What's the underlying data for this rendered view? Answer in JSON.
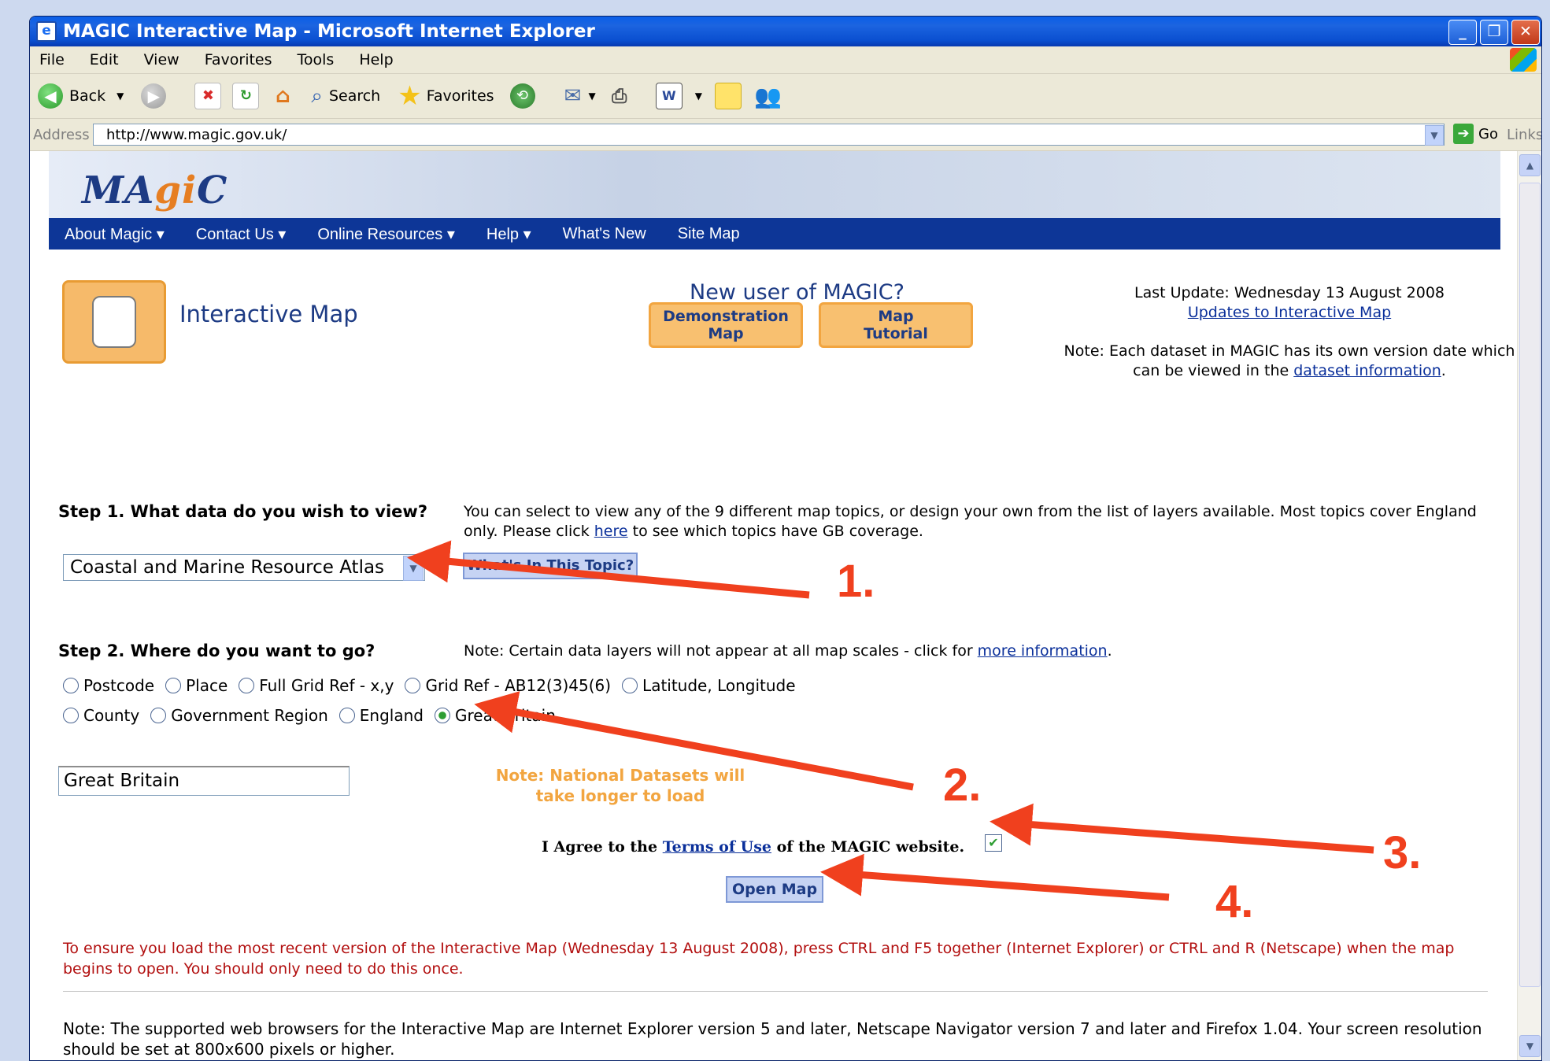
{
  "window": {
    "title": "MAGIC Interactive Map - Microsoft Internet Explorer"
  },
  "menu": [
    "File",
    "Edit",
    "View",
    "Favorites",
    "Tools",
    "Help"
  ],
  "toolbar": {
    "back": "Back",
    "search": "Search",
    "favorites": "Favorites"
  },
  "address": {
    "label": "Address",
    "url": "http://www.magic.gov.uk/",
    "go": "Go",
    "links": "Links"
  },
  "site": {
    "logo_pre": "MA",
    "logo_mid": "gi",
    "logo_post": "C",
    "nav": [
      "About Magic ▾",
      "Contact Us ▾",
      "Online Resources ▾",
      "Help ▾",
      "What's New",
      "Site Map"
    ]
  },
  "header": {
    "title": "Interactive Map",
    "new_user": "New user of MAGIC?",
    "demo_btn_line1": "Demonstration",
    "demo_btn_line2": "Map",
    "tutorial_btn_line1": "Map",
    "tutorial_btn_line2": "Tutorial",
    "last_update": "Last Update: Wednesday 13 August 2008",
    "updates_link": "Updates to Interactive Map",
    "note_pre": "Note: Each dataset in MAGIC has its own version date which can be viewed in the ",
    "note_link": "dataset information",
    "note_post": "."
  },
  "step1": {
    "label": "Step 1.  What data do you wish to view?",
    "note_pre": "You can select to view any of the 9 different map topics, or design your own from the list of layers available. Most topics cover England only. Please click ",
    "note_link": "here",
    "note_post": " to see which topics have GB coverage.",
    "select_value": "Coastal and Marine Resource Atlas",
    "topic_button": "What's In This Topic?"
  },
  "step2": {
    "label": "Step 2.  Where do you want to go?",
    "note_pre": "Note: Certain data layers will not appear at all map scales - click for ",
    "note_link": "more information",
    "note_post": ".",
    "radios_row1": [
      "Postcode",
      "Place",
      "Full Grid Ref - x,y",
      "Grid Ref - AB12(3)45(6)",
      "Latitude, Longitude"
    ],
    "radios_row2": [
      "County",
      "Government Region",
      "England",
      "Great Britain"
    ],
    "selected": "Great Britain",
    "input_value": "Great Britain",
    "national_note_line1": "Note: National Datasets will",
    "national_note_line2": "take longer to load"
  },
  "agree": {
    "pre": "I Agree to the ",
    "link": "Terms of Use",
    "post": " of the MAGIC website.",
    "checked": true
  },
  "open_map": "Open Map",
  "red_note": "To ensure you load the most recent version of the Interactive Map (Wednesday 13 August 2008), press CTRL and F5 together (Internet Explorer) or CTRL and R (Netscape) when the map begins to open. You should only need to do this once.",
  "bottom_note": "Note: The supported web browsers for the Interactive Map are Internet Explorer version 5 and later, Netscape Navigator version 7 and later and Firefox 1.04. Your screen resolution should be set at 800x600 pixels or higher.",
  "annotations": [
    "1.",
    "2.",
    "3.",
    "4."
  ],
  "colors": {
    "arrow": "#f0401e",
    "nav": "#0d3697",
    "orange": "#f2a540",
    "red_note": "#b20f0f"
  }
}
